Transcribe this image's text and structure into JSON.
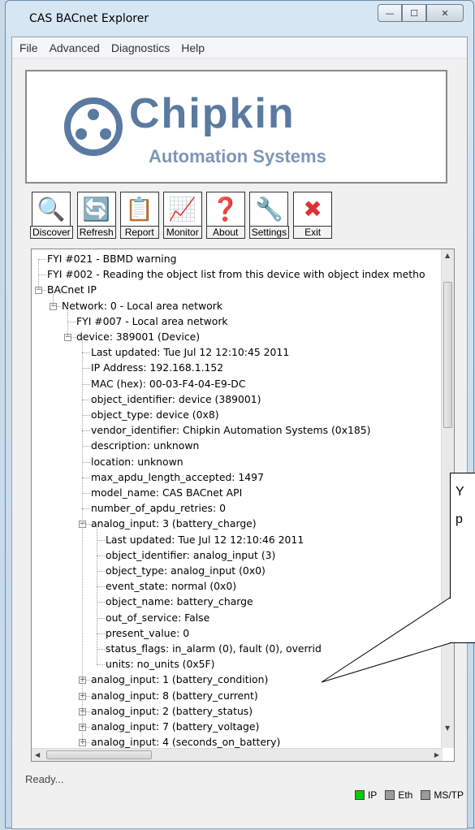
{
  "window": {
    "title": "CAS BACnet Explorer",
    "minimize": "—",
    "maximize": "☐",
    "close": "✕"
  },
  "menu": [
    "File",
    "Advanced",
    "Diagnostics",
    "Help"
  ],
  "logo": {
    "name": "Chipkin",
    "subtitle": "Automation Systems",
    "color": "#5a7aa0"
  },
  "toolbar": [
    {
      "label": "Discover",
      "icon": "magnifier-icon",
      "glyph": "🔍"
    },
    {
      "label": "Refresh",
      "icon": "refresh-icon",
      "glyph": "🔄"
    },
    {
      "label": "Report",
      "icon": "clipboard-icon",
      "glyph": "📋"
    },
    {
      "label": "Monitor",
      "icon": "monitor-icon",
      "glyph": "📈"
    },
    {
      "label": "About",
      "icon": "help-icon",
      "glyph": "❓"
    },
    {
      "label": "Settings",
      "icon": "tools-icon",
      "glyph": "🔧"
    },
    {
      "label": "Exit",
      "icon": "exit-icon",
      "glyph": "✖"
    }
  ],
  "tree": [
    {
      "text": "FYI #021 - BBMD warning",
      "level": 0,
      "exp": ""
    },
    {
      "text": "FYI #002 - Reading the object list from this device with object index metho",
      "level": 0,
      "exp": ""
    },
    {
      "text": "BACnet IP",
      "level": 0,
      "exp": "-"
    },
    {
      "text": "Network: 0 - Local area network",
      "level": 1,
      "exp": "-"
    },
    {
      "text": "FYI #007 - Local area network",
      "level": 2,
      "exp": ""
    },
    {
      "text": "device: 389001  (Device)",
      "level": 2,
      "exp": "-"
    },
    {
      "text": "Last updated: Tue Jul 12 12:10:45 2011",
      "level": 3,
      "exp": ""
    },
    {
      "text": "IP Address: 192.168.1.152",
      "level": 3,
      "exp": ""
    },
    {
      "text": "MAC (hex): 00-03-F4-04-E9-DC",
      "level": 3,
      "exp": ""
    },
    {
      "text": "object_identifier: device (389001)",
      "level": 3,
      "exp": ""
    },
    {
      "text": "object_type: device (0x8)",
      "level": 3,
      "exp": ""
    },
    {
      "text": "vendor_identifier: Chipkin Automation Systems (0x185)",
      "level": 3,
      "exp": ""
    },
    {
      "text": "description: unknown",
      "level": 3,
      "exp": ""
    },
    {
      "text": "location: unknown",
      "level": 3,
      "exp": ""
    },
    {
      "text": "max_apdu_length_accepted: 1497",
      "level": 3,
      "exp": ""
    },
    {
      "text": "model_name: CAS BACnet API",
      "level": 3,
      "exp": ""
    },
    {
      "text": "number_of_apdu_retries: 0",
      "level": 3,
      "exp": ""
    },
    {
      "text": "analog_input: 3  (battery_charge)",
      "level": 3,
      "exp": "-"
    },
    {
      "text": "Last updated: Tue Jul 12 12:10:46 2011",
      "level": 4,
      "exp": ""
    },
    {
      "text": "object_identifier: analog_input (3)",
      "level": 4,
      "exp": ""
    },
    {
      "text": "object_type: analog_input (0x0)",
      "level": 4,
      "exp": ""
    },
    {
      "text": "event_state: normal (0x0)",
      "level": 4,
      "exp": ""
    },
    {
      "text": "object_name: battery_charge",
      "level": 4,
      "exp": ""
    },
    {
      "text": "out_of_service: False",
      "level": 4,
      "exp": ""
    },
    {
      "text": "present_value: 0",
      "level": 4,
      "exp": ""
    },
    {
      "text": "status_flags: in_alarm (0), fault (0), overrid",
      "level": 4,
      "exp": ""
    },
    {
      "text": "units: no_units (0x5F)",
      "level": 4,
      "exp": ""
    },
    {
      "text": "analog_input: 1  (battery_condition)",
      "level": 3,
      "exp": "+"
    },
    {
      "text": "analog_input: 8  (battery_current)",
      "level": 3,
      "exp": "+"
    },
    {
      "text": "analog_input: 2  (battery_status)",
      "level": 3,
      "exp": "+"
    },
    {
      "text": "analog_input: 7  (battery_voltage)",
      "level": 3,
      "exp": "+"
    },
    {
      "text": "analog_input: 4  (seconds_on_battery)",
      "level": 3,
      "exp": "+"
    }
  ],
  "callout": {
    "line1": "Y",
    "line2": "p"
  },
  "status": {
    "text": "Ready...",
    "leds": [
      {
        "label": "IP",
        "color": "#00cc00"
      },
      {
        "label": "Eth",
        "color": "#9a9a9a"
      },
      {
        "label": "MS/TP",
        "color": "#9a9a9a"
      }
    ]
  }
}
